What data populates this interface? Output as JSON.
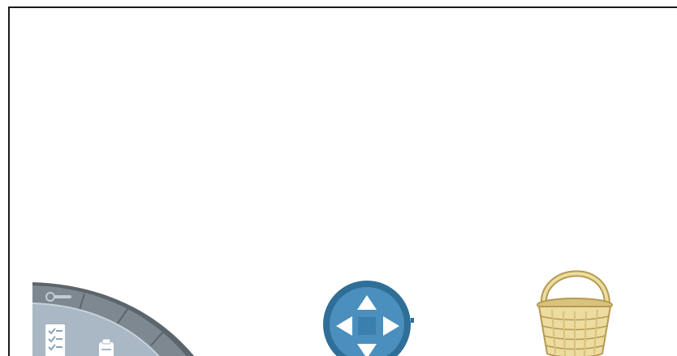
{
  "screen": {
    "background": "#ffffff",
    "frame_color": "#1a1a1a"
  },
  "radial_menu": {
    "items": [
      {
        "icon": "wrench-icon"
      },
      {
        "icon": "checklist-icon"
      },
      {
        "icon": "notes-icon"
      }
    ],
    "colors": {
      "rim": "#7e8890",
      "rim_dark": "#5c656c",
      "inner": "#a9b8c4",
      "icon": "#ffffff"
    }
  },
  "navigation_pad": {
    "icon": "move-arrows-icon",
    "colors": {
      "outer": "#2f6f97",
      "inner": "#4a8fbd",
      "arrows": "#ffffff"
    }
  },
  "basket": {
    "icon": "wicker-basket-icon",
    "colors": {
      "light": "#ecdca0",
      "mid": "#d8c27c",
      "dark": "#b69a52"
    }
  }
}
